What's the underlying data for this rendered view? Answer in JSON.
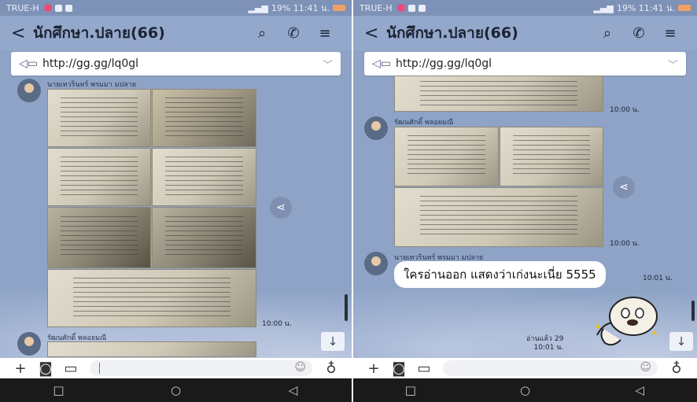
{
  "left": {
    "status": {
      "carrier": "TRUE-H",
      "right": "19% 11:41 น."
    },
    "header": {
      "back": "<",
      "title": "นักศึกษา.ปลาย(66)",
      "search": "⌕",
      "call": "✆",
      "menu": "≡"
    },
    "announcement": {
      "url": "http://gg.gg/lq0gl"
    },
    "messages": [
      {
        "sender": "นายเทวรินทร์ พรมมา มปลาย",
        "time": "10:00 น."
      },
      {
        "sender": "รัฒนศักดิ์ พลอยมณี"
      }
    ]
  },
  "right": {
    "status": {
      "carrier": "TRUE-H",
      "right": "19% 11:41 น."
    },
    "header": {
      "back": "<",
      "title": "นักศึกษา.ปลาย(66)",
      "search": "⌕",
      "call": "✆",
      "menu": "≡"
    },
    "announcement": {
      "url": "http://gg.gg/lq0gl"
    },
    "messages": [
      {
        "time": "10:00 น."
      },
      {
        "sender": "รัฒนศักดิ์ พลอยมณี",
        "time": "10:00 น."
      },
      {
        "sender": "นายเทวรินทร์ พรมมา มปลาย",
        "text": "ใครอ่านออก แสดงว่าเก่งนะเนี่ย 5555",
        "time": "10:01 น."
      },
      {
        "read": "อ่านแล้ว 29",
        "time": "10:01 น."
      }
    ]
  },
  "input": {
    "plus": "+",
    "camera": "◙",
    "image": "▭",
    "emoji": "☺",
    "mic": "♁"
  },
  "nav": {
    "recents": "□",
    "home": "○",
    "back": "◁"
  },
  "colors": {
    "chat_bg": "#8ea3c6",
    "header": "#94a8cc",
    "bubble": "#ffffff"
  }
}
